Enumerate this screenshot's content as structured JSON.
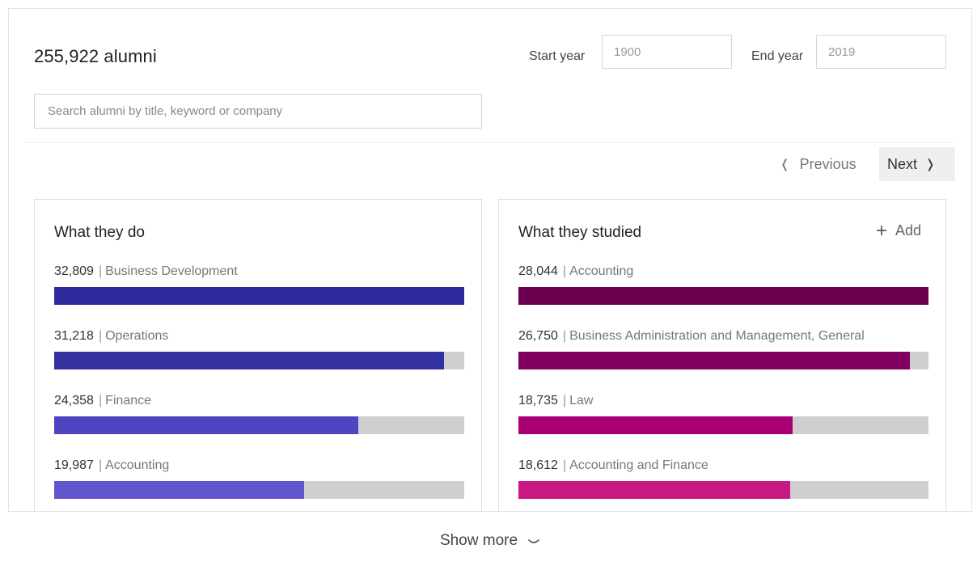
{
  "header": {
    "alumni_count": "255,922 alumni",
    "start_year_label": "Start year",
    "start_year_value": "1900",
    "end_year_label": "End year",
    "end_year_value": "2019"
  },
  "search": {
    "placeholder": "Search alumni by title, keyword or company",
    "value": ""
  },
  "pager": {
    "previous_label": "Previous",
    "next_label": "Next",
    "previous_icon": "chevron-left-icon",
    "next_icon": "chevron-right-icon"
  },
  "what_they_do": {
    "title": "What they do",
    "max": 32809,
    "items": [
      {
        "count": "32,809",
        "value": 32809,
        "label": "Business Development",
        "color": "#2e2a9c"
      },
      {
        "count": "31,218",
        "value": 31218,
        "label": "Operations",
        "color": "#33309f"
      },
      {
        "count": "24,358",
        "value": 24358,
        "label": "Finance",
        "color": "#4d44bf"
      },
      {
        "count": "19,987",
        "value": 19987,
        "label": "Accounting",
        "color": "#6057cf"
      }
    ]
  },
  "what_they_studied": {
    "title": "What they studied",
    "add_label": "Add",
    "add_icon": "plus-icon",
    "max": 28044,
    "items": [
      {
        "count": "28,044",
        "value": 28044,
        "label": "Accounting",
        "color": "#6b0050"
      },
      {
        "count": "26,750",
        "value": 26750,
        "label": "Business Administration and Management, General",
        "color": "#82005f"
      },
      {
        "count": "18,735",
        "value": 18735,
        "label": "Law",
        "color": "#a80074"
      },
      {
        "count": "18,612",
        "value": 18612,
        "label": "Accounting and Finance",
        "color": "#c81883"
      }
    ]
  },
  "footer": {
    "show_more_label": "Show more",
    "show_more_icon": "chevron-down-icon"
  },
  "colors": {
    "bar_track": "#cfcfd1",
    "next_button_bg": "#efefef"
  }
}
